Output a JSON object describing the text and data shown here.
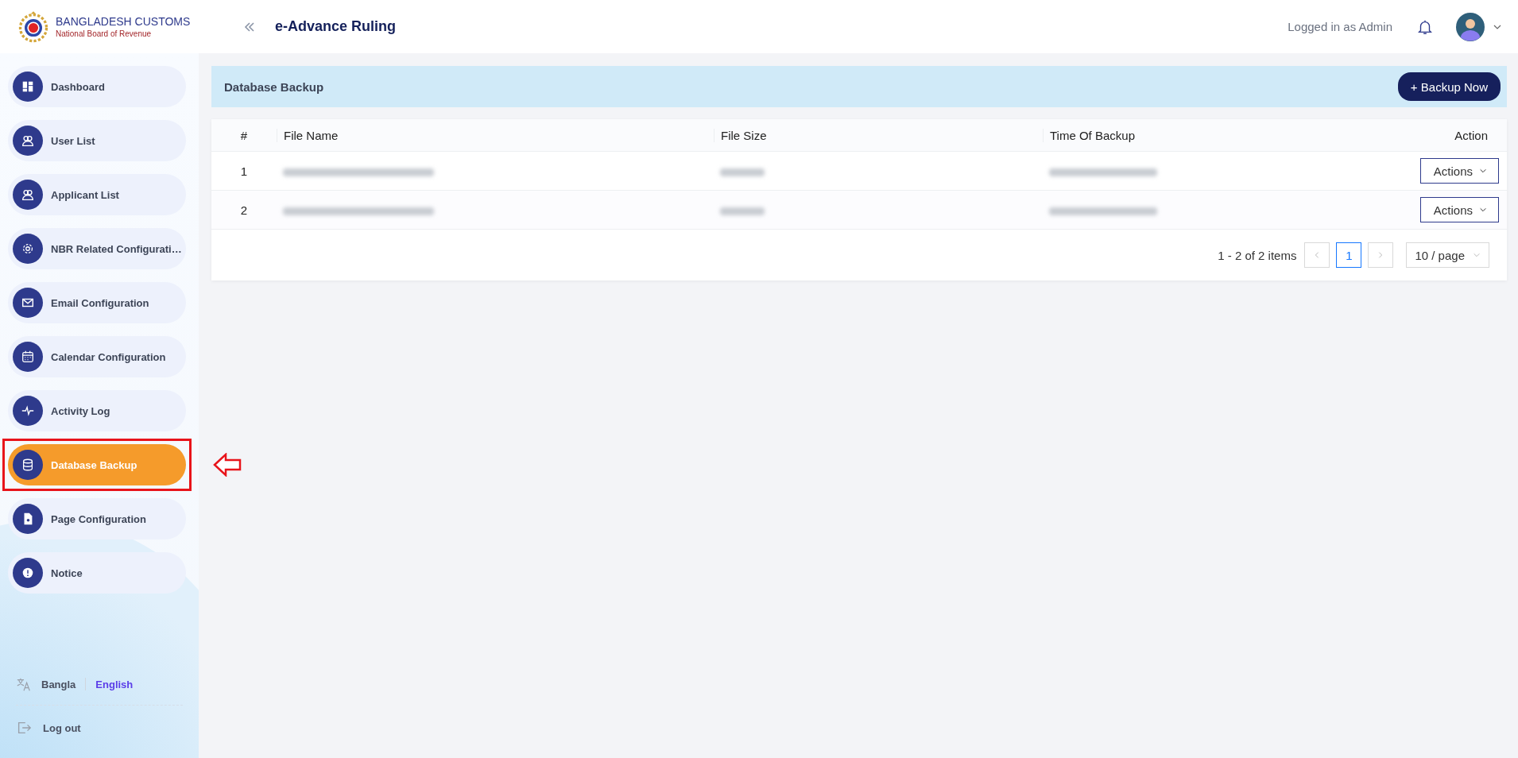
{
  "logo": {
    "title": "BANGLADESH CUSTOMS",
    "subtitle": "National Board of Revenue"
  },
  "header": {
    "title": "e-Advance Ruling",
    "user_label": "Logged in as Admin"
  },
  "sidebar": {
    "items": [
      {
        "label": "Dashboard",
        "selected": false
      },
      {
        "label": "User List",
        "selected": false
      },
      {
        "label": "Applicant List",
        "selected": false
      },
      {
        "label": "NBR Related Configurati…",
        "selected": false
      },
      {
        "label": "Email Configuration",
        "selected": false
      },
      {
        "label": "Calendar Configuration",
        "selected": false
      },
      {
        "label": "Activity Log",
        "selected": false
      },
      {
        "label": "Database Backup",
        "selected": true
      },
      {
        "label": "Page Configuration",
        "selected": false
      },
      {
        "label": "Notice",
        "selected": false
      }
    ],
    "languages": [
      {
        "label": "Bangla",
        "selected": false
      },
      {
        "label": "English",
        "selected": true
      }
    ],
    "logout": "Log out"
  },
  "page": {
    "title": "Database Backup",
    "primary_button": "+ Backup Now"
  },
  "table": {
    "columns": [
      "#",
      "File Name",
      "File Size",
      "Time Of Backup",
      "Action"
    ],
    "rows": [
      {
        "index": "1",
        "action": "Actions"
      },
      {
        "index": "2",
        "action": "Actions"
      }
    ]
  },
  "pagination": {
    "summary": "1 - 2 of 2 items",
    "pages": [
      {
        "label": "1",
        "selected": true
      }
    ],
    "page_size": "10 / page"
  }
}
